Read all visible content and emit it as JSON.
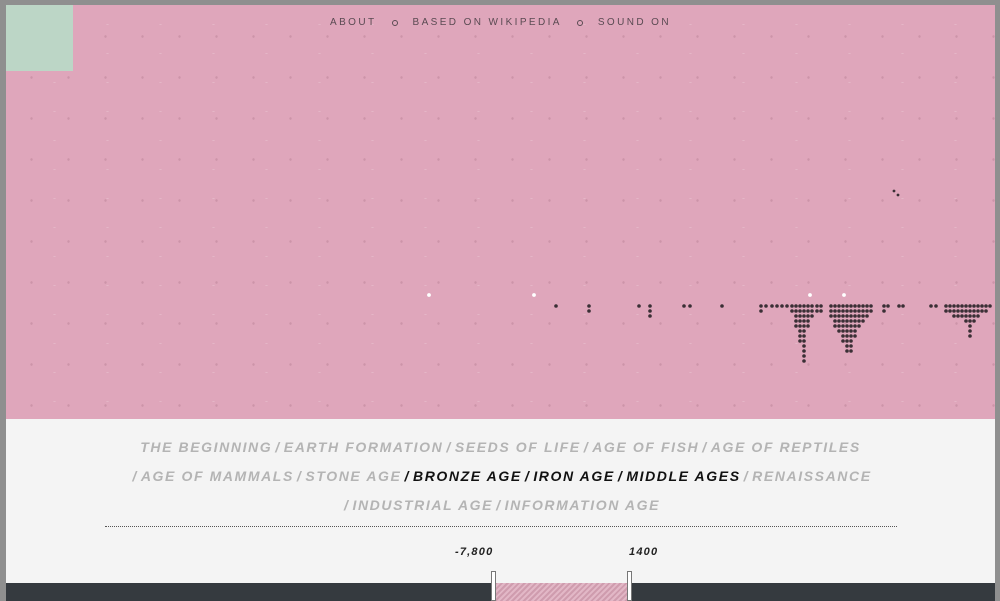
{
  "nav": {
    "items": [
      {
        "label": "ABOUT"
      },
      {
        "label": "BASED ON WIKIPEDIA"
      },
      {
        "label": "SOUND ON"
      }
    ]
  },
  "eras": [
    {
      "label": "THE BEGINNING",
      "active": false
    },
    {
      "label": "EARTH FORMATION",
      "active": false
    },
    {
      "label": "SEEDS OF LIFE",
      "active": false
    },
    {
      "label": "AGE OF FISH",
      "active": false
    },
    {
      "label": "AGE OF REPTILES",
      "active": false
    },
    {
      "label": "AGE OF MAMMALS",
      "active": false
    },
    {
      "label": "STONE AGE",
      "active": false
    },
    {
      "label": "BRONZE AGE",
      "active": true
    },
    {
      "label": "IRON AGE",
      "active": true
    },
    {
      "label": "MIDDLE AGES",
      "active": true
    },
    {
      "label": "RENAISSANCE",
      "active": false
    },
    {
      "label": "INDUSTRIAL AGE",
      "active": false
    },
    {
      "label": "INFORMATION AGE",
      "active": false
    }
  ],
  "era_separator": "/",
  "timeline": {
    "range_start_label": "-7,800",
    "range_end_label": "1400"
  },
  "colors": {
    "stage_background": "#dfa6bb",
    "corner_square": "#bcd6c6",
    "active_era": "#111111",
    "inactive_era": "#b4b4b4",
    "timeline_bar": "#353a3f"
  }
}
